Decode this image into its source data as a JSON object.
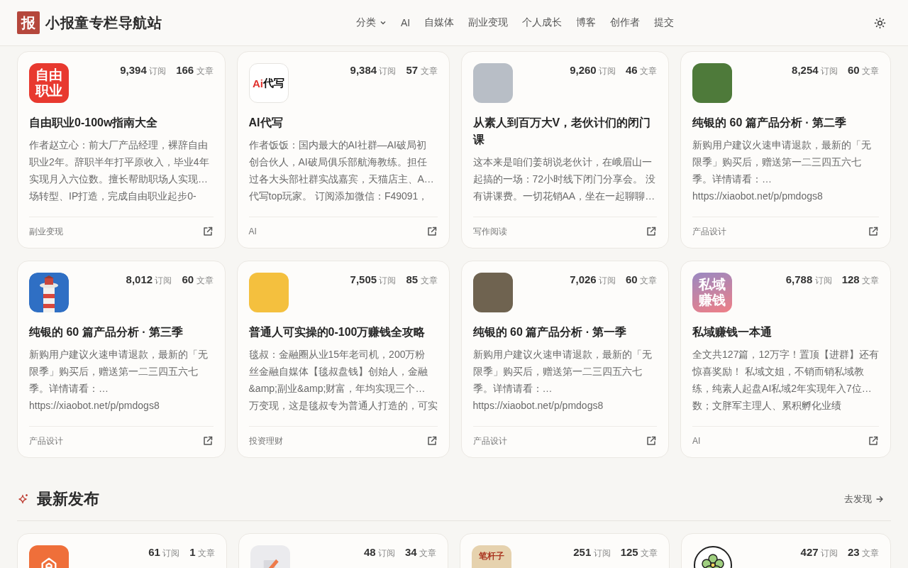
{
  "header": {
    "logo_text": "报",
    "title": "小报童专栏导航站",
    "nav": [
      {
        "label": "分类",
        "kind": "dropdown"
      },
      {
        "label": "AI",
        "kind": "link"
      },
      {
        "label": "自媒体",
        "kind": "link"
      },
      {
        "label": "副业变现",
        "kind": "link"
      },
      {
        "label": "个人成长",
        "kind": "link"
      },
      {
        "label": "博客",
        "kind": "link"
      },
      {
        "label": "创作者",
        "kind": "link"
      },
      {
        "label": "提交",
        "kind": "link"
      }
    ]
  },
  "cards": [
    {
      "cover": {
        "kind": "text-tile",
        "color": "#e8392f",
        "text": "自由职业"
      },
      "stats": [
        "**9,394** 订阅",
        "**166** 文章"
      ],
      "title": "自由职业0-100w指南大全",
      "description_lines": [
        "作者赵立心：前大厂产品经理，裸辞自由",
        "职业2年。辞职半年打平原收入，毕业4年",
        "实现月入六位数。擅长帮助职场人实现…",
        "场转型、IP打造，完成自由职业起步0-"
      ],
      "category": "副业变现"
    },
    {
      "cover": {
        "kind": "wordmark",
        "accent": "Ai",
        "text": "代写"
      },
      "stats": [
        "**9,384** 订阅",
        "**57** 文章"
      ],
      "title": "AI代写",
      "description_lines": [
        "作者饭饭：国内最大的AI社群—AI破局初",
        "创合伙人，AI破局俱乐部航海教练。担任",
        "过各大头部社群实战嘉宾，天猫店主、A…",
        "代写top玩家。 订阅添加微信：F49091，"
      ],
      "category": "AI"
    },
    {
      "cover": {
        "kind": "photo",
        "color": "#b8bec6"
      },
      "stats": [
        "**9,260** 订阅",
        "**46** 文章"
      ],
      "title": "从素人到百万大V，老伙计们的闭门课",
      "description_lines": [
        "这本来是咱们姜胡说老伙计，在峨眉山一",
        "起搞的一场：72小时线下闭门分享会。 没",
        "有讲课费。一切花销AA，坐在一起聊聊…"
      ],
      "category": "写作阅读"
    },
    {
      "cover": {
        "kind": "photo",
        "color": "#4e7a3a"
      },
      "stats": [
        "**8,254** 订阅",
        "**60** 文章"
      ],
      "title": "纯银的 60 篇产品分析 · 第二季",
      "description_lines": [
        "新购用户建议火速申请退款，最新的「无",
        "限季」购买后，赠送第一二三四五六七",
        "季。详情请看：…",
        "https://xiaobot.net/p/pmdogs8"
      ],
      "category": "产品设计"
    },
    {
      "cover": {
        "kind": "lighthouse"
      },
      "stats": [
        "**8,012** 订阅",
        "**60** 文章"
      ],
      "title": "纯银的 60 篇产品分析 · 第三季",
      "description_lines": [
        "新购用户建议火速申请退款，最新的「无",
        "限季」购买后，赠送第一二三四五六七",
        "季。详情请看：…",
        "https://xiaobot.net/p/pmdogs8"
      ],
      "category": "产品设计"
    },
    {
      "cover": {
        "kind": "photo",
        "color": "#f4c03e"
      },
      "stats": [
        "**7,505** 订阅",
        "**85** 文章"
      ],
      "title": "普通人可实操的0-100万赚钱全攻略",
      "description_lines": [
        "毯叔：金融圈从业15年老司机，200万粉",
        "丝金融自媒体【毯叔盘钱】创始人，金融",
        "&amp;副业&amp;财富，年均实现三个…",
        "万变现，这是毯叔专为普通人打造的，可实"
      ],
      "category": "投资理财"
    },
    {
      "cover": {
        "kind": "photo",
        "color": "#6f6350"
      },
      "stats": [
        "**7,026** 订阅",
        "**60** 文章"
      ],
      "title": "纯银的 60 篇产品分析 · 第一季",
      "description_lines": [
        "新购用户建议火速申请退款，最新的「无",
        "限季」购买后，赠送第一二三四五六七",
        "季。详情请看：…",
        "https://xiaobot.net/p/pmdogs8"
      ],
      "category": "产品设计"
    },
    {
      "cover": {
        "kind": "gradient-tile",
        "text": "私域赚钱"
      },
      "stats": [
        "**6,788** 订阅",
        "**128** 文章"
      ],
      "title": "私域赚钱一本通",
      "description_lines": [
        "全文共127篇，12万字！置顶【进群】还有",
        "惊喜奖励！ 私域文姐，不销而销私域教",
        "练，纯素人起盘AI私域2年实现年入7位…",
        "数；文胖军主理人、累积孵化业绩"
      ],
      "category": "AI"
    }
  ],
  "latest": {
    "title": "最新发布",
    "link": "去发现",
    "cards": [
      {
        "cover": {
          "kind": "house-tile",
          "color": "#ef6f3a"
        },
        "stats": [
          "**61** 订阅",
          "**1** 文章"
        ]
      },
      {
        "cover": {
          "kind": "pencil-tile"
        },
        "stats": [
          "**48** 订阅",
          "**34** 文章"
        ]
      },
      {
        "cover": {
          "kind": "paper-tile",
          "text": "笔杆子"
        },
        "stats": [
          "**251** 订阅",
          "**125** 文章"
        ]
      },
      {
        "cover": {
          "kind": "flower-circle"
        },
        "stats": [
          "**427** 订阅",
          "**23** 文章"
        ]
      }
    ]
  }
}
